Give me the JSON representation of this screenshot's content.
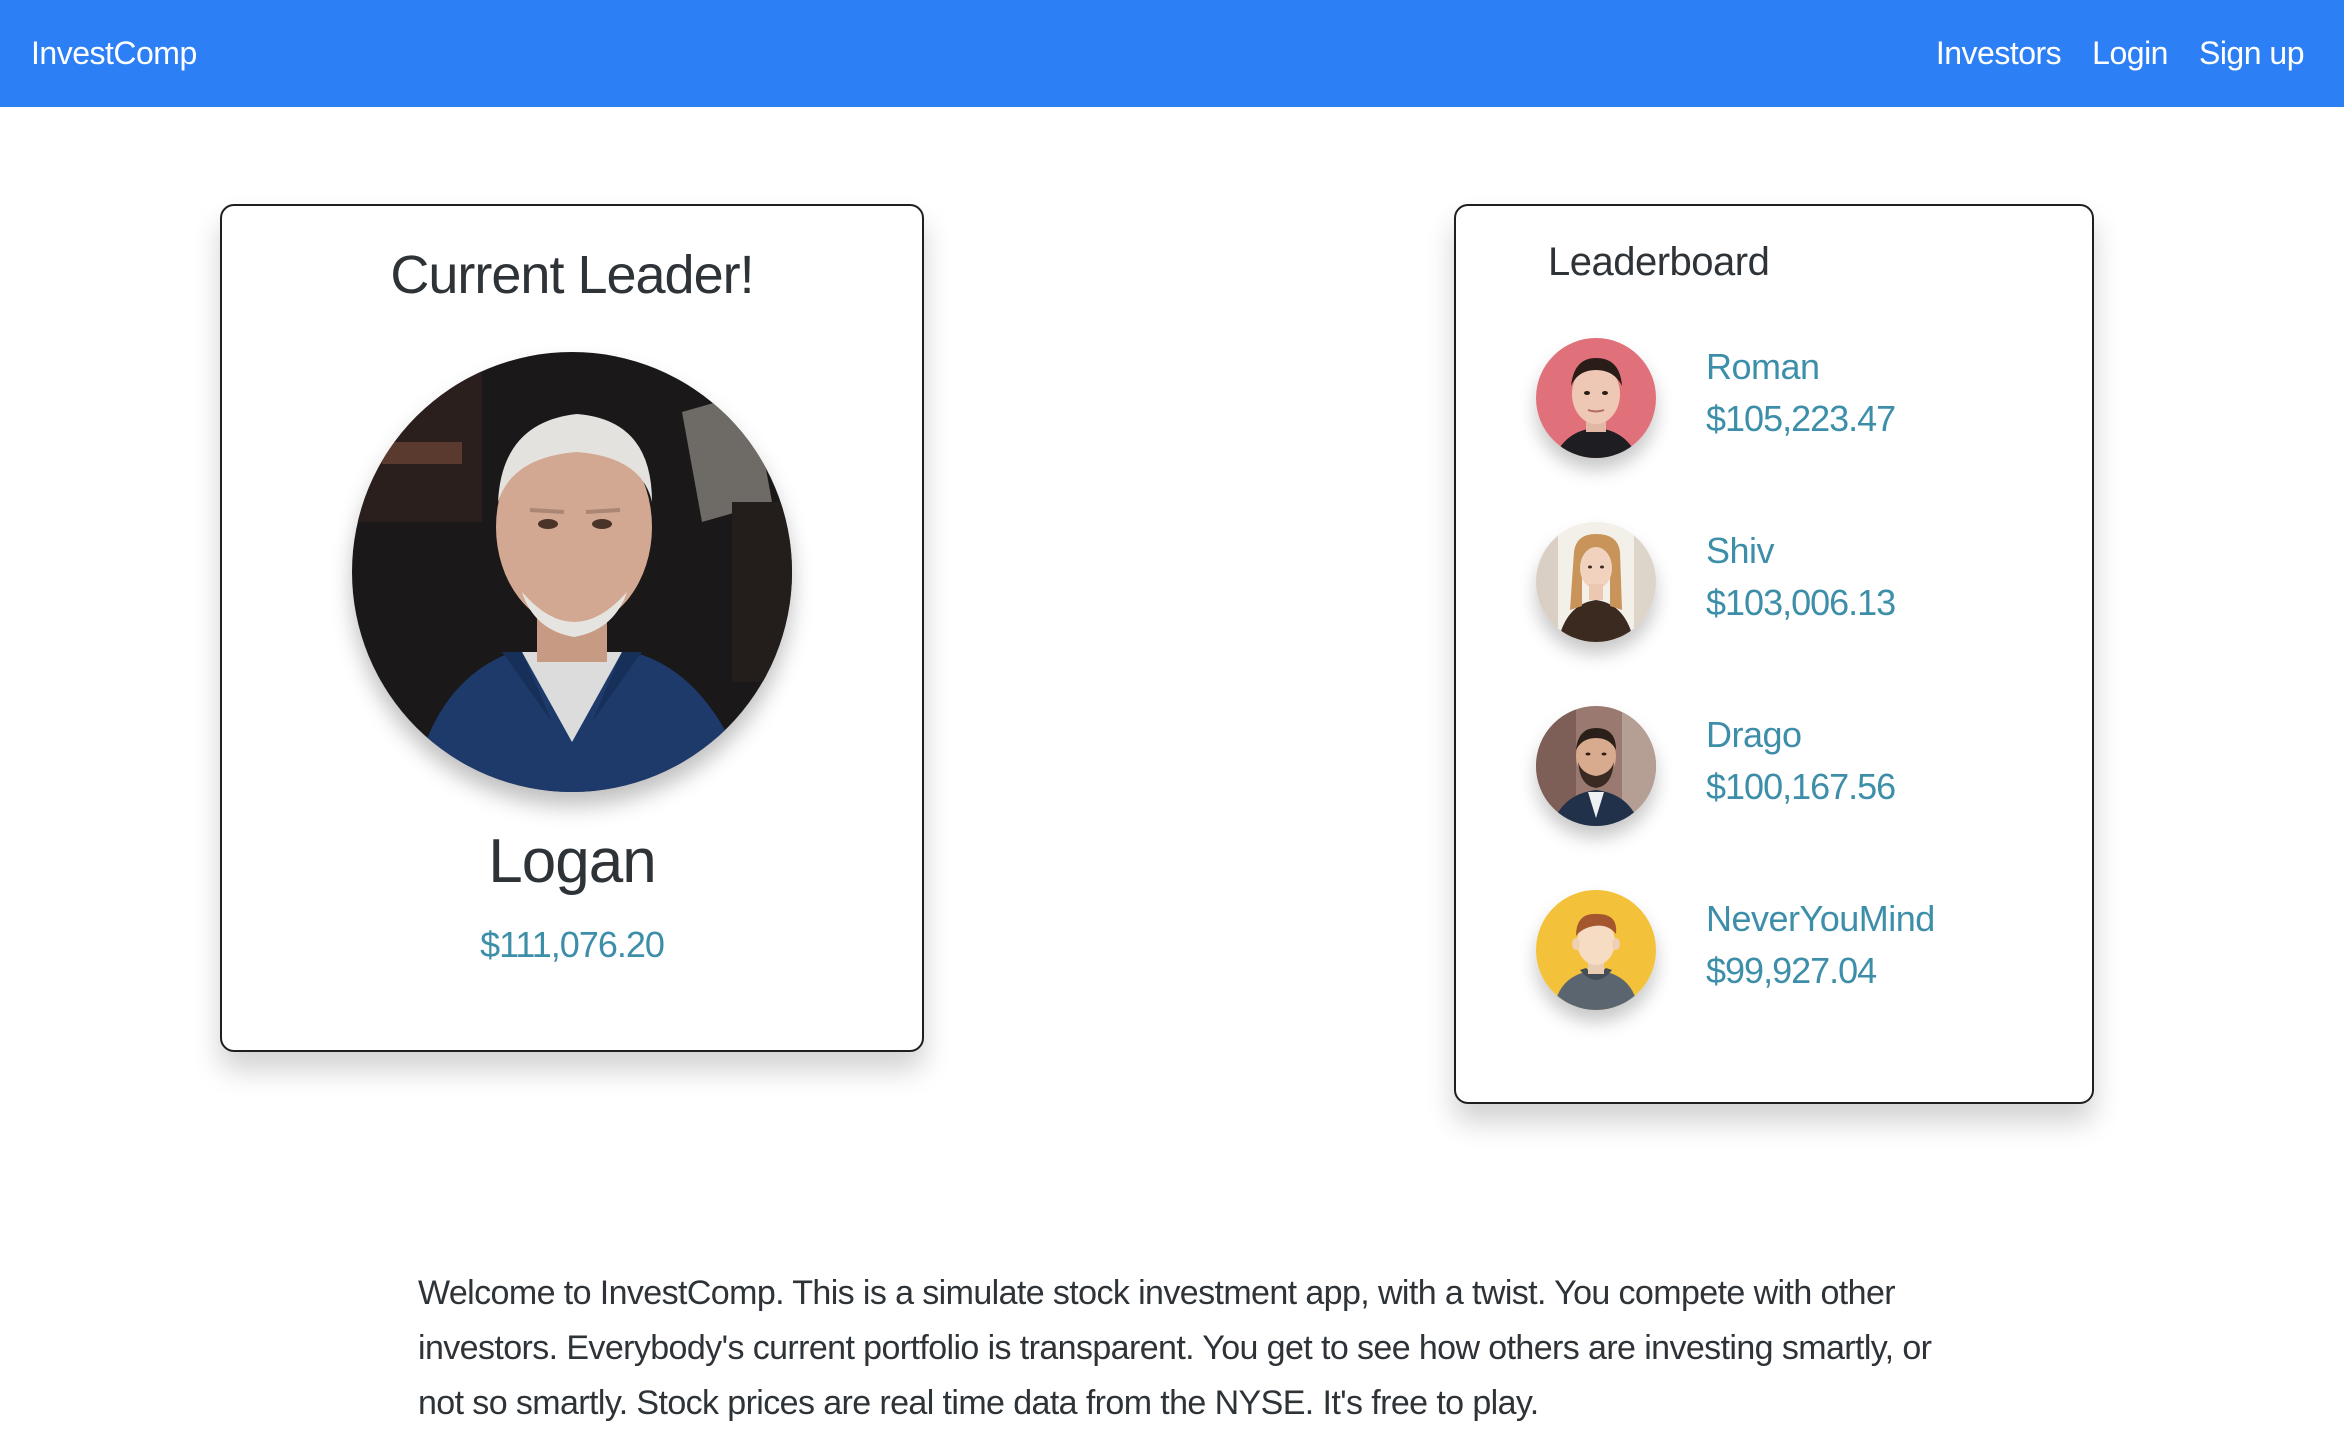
{
  "navbar": {
    "brand": "InvestComp",
    "links": [
      "Investors",
      "Login",
      "Sign up"
    ],
    "background": "#2c7ff4"
  },
  "leader": {
    "title": "Current Leader!",
    "name": "Logan",
    "value": "$111,076.20",
    "photo_icon": "leader-photo"
  },
  "leaderboard": {
    "title": "Leaderboard",
    "items": [
      {
        "name": "Roman",
        "value": "$105,223.47",
        "avatar": "roman-avatar"
      },
      {
        "name": "Shiv",
        "value": "$103,006.13",
        "avatar": "shiv-avatar"
      },
      {
        "name": "Drago",
        "value": "$100,167.56",
        "avatar": "drago-avatar"
      },
      {
        "name": "NeverYouMind",
        "value": "$99,927.04",
        "avatar": "default-user-avatar"
      }
    ]
  },
  "intro": {
    "text": "Welcome to InvestComp. This is a simulate stock investment app, with a twist. You compete with other investors. Everybody's current portfolio is transparent. You get to see how others are investing smartly, or not so smartly. Stock prices are real time data from the NYSE. It's free to play."
  },
  "colors": {
    "accent_text": "#3d8ea9",
    "heading_text": "#2e3338"
  }
}
